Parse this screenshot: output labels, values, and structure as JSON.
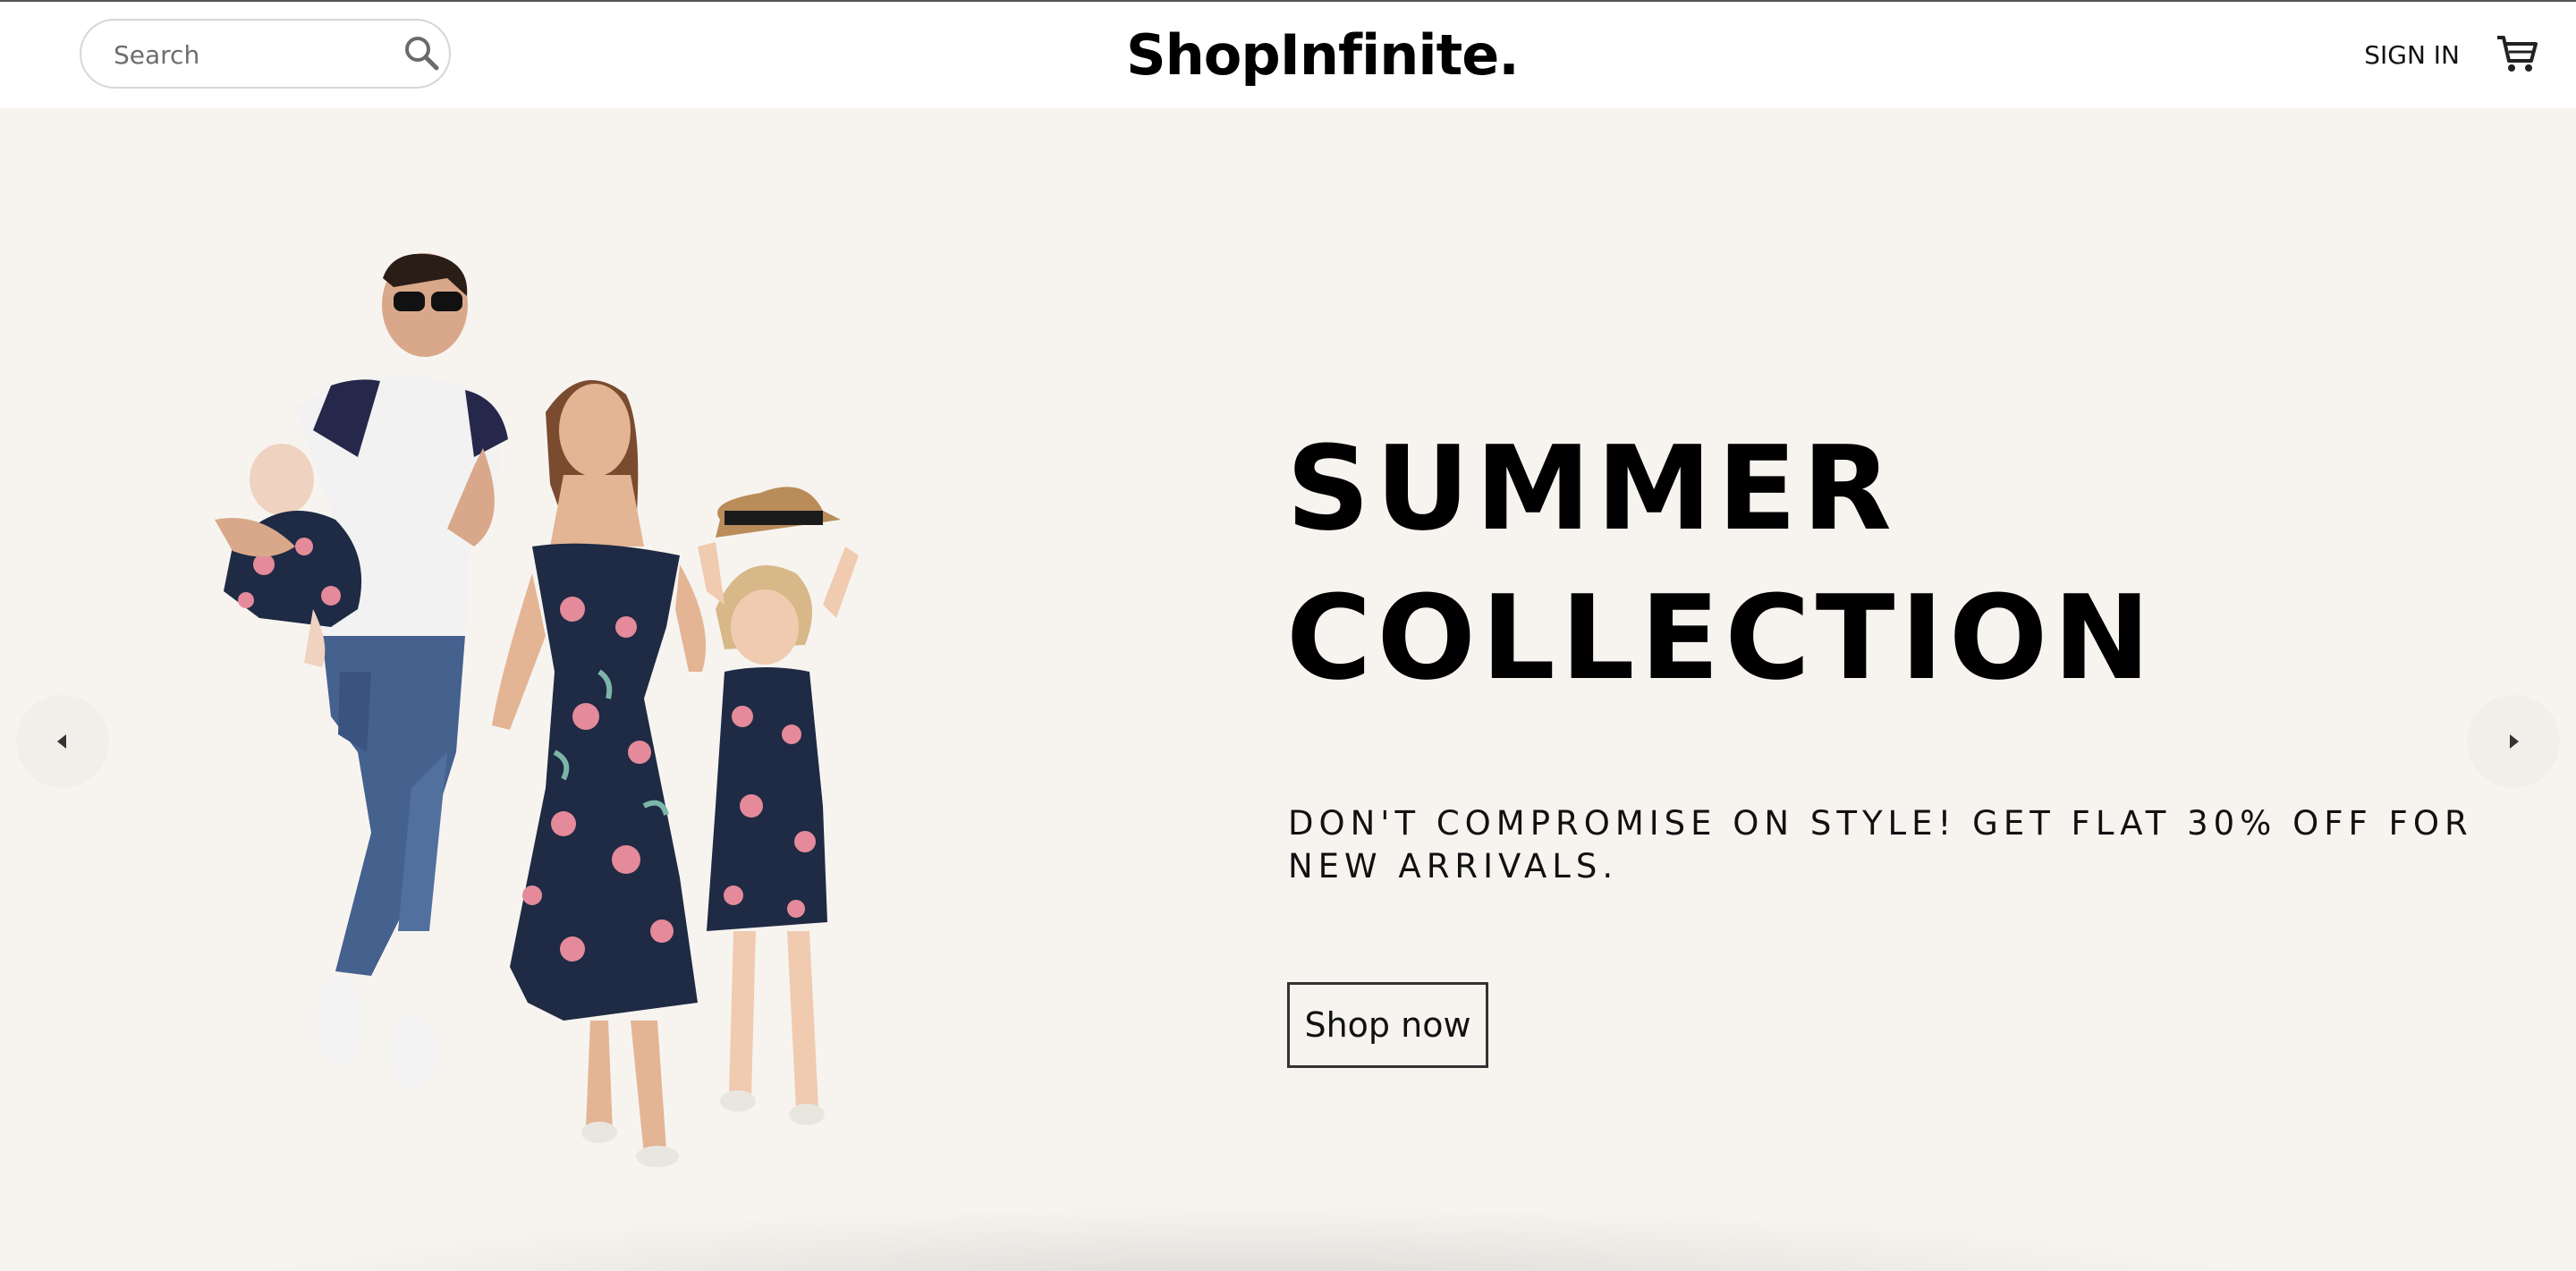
{
  "header": {
    "search": {
      "placeholder": "Search",
      "value": ""
    },
    "logo": "ShopInfinite.",
    "sign_in_label": "SIGN IN",
    "search_icon": "search-icon",
    "cart_icon": "shopping-cart-icon"
  },
  "hero": {
    "title_line_1": "SUMMER",
    "title_line_2": "COLLECTION",
    "subtitle": "DON'T COMPROMISE ON STYLE! GET FLAT 30% OFF FOR NEW ARRIVALS.",
    "cta_label": "Shop now",
    "image_icon": "family-photo",
    "prev_icon": "chevron-left-icon",
    "next_icon": "chevron-right-icon"
  },
  "colors": {
    "background": "#f7f4f0",
    "header": "#ffffff",
    "text": "#000000",
    "dress_navy": "#1f2a44",
    "flower_pink": "#e48a9a"
  }
}
